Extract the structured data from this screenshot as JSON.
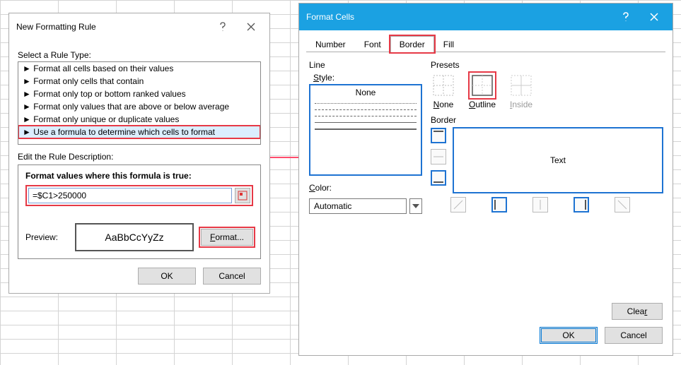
{
  "newRule": {
    "title": "New Formatting Rule",
    "selectLabel": "Select a Rule Type:",
    "ruleTypes": [
      "Format all cells based on their values",
      "Format only cells that contain",
      "Format only top or bottom ranked values",
      "Format only values that are above or below average",
      "Format only unique or duplicate values",
      "Use a formula to determine which cells to format"
    ],
    "editLabel": "Edit the Rule Description:",
    "formulaLabel": "Format values where this formula is true:",
    "formulaValue": "=$C1>250000",
    "previewLabel": "Preview:",
    "previewSample": "AaBbCcYyZz",
    "formatBtn": "Format...",
    "ok": "OK",
    "cancel": "Cancel"
  },
  "formatCells": {
    "title": "Format Cells",
    "tabs": {
      "number": "Number",
      "font": "Font",
      "border": "Border",
      "fill": "Fill"
    },
    "line": {
      "label": "Line",
      "styleLabel": "Style:",
      "none": "None",
      "colorLabel": "Color:",
      "colorValue": "Automatic"
    },
    "presets": {
      "label": "Presets",
      "none": "None",
      "outline": "Outline",
      "inside": "Inside"
    },
    "border": {
      "label": "Border",
      "previewText": "Text"
    },
    "clear": "Clear",
    "ok": "OK",
    "cancel": "Cancel"
  }
}
